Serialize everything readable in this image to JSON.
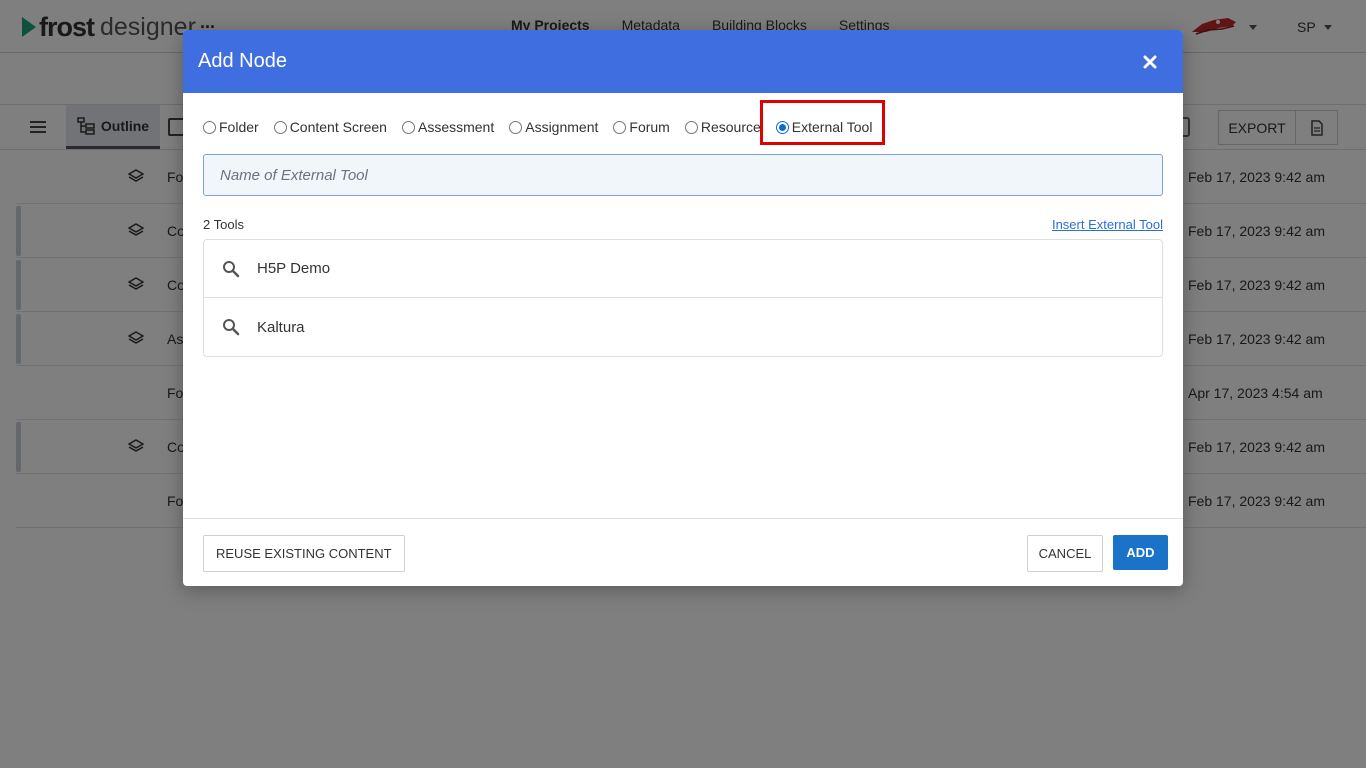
{
  "app": {
    "logo_primary": "frost",
    "logo_secondary": "designer",
    "more_label": "...",
    "nav": [
      "My Projects",
      "Metadata",
      "Building Blocks",
      "Settings"
    ],
    "user_initials": "SP"
  },
  "toolbar": {
    "outline_label": "Outline",
    "export_label": "EXPORT"
  },
  "background_rows": [
    {
      "name": "Fo",
      "date": "Feb 17, 2023 9:42 am"
    },
    {
      "name": "Co",
      "date": "Feb 17, 2023 9:42 am"
    },
    {
      "name": "Co",
      "date": "Feb 17, 2023 9:42 am"
    },
    {
      "name": "As",
      "date": "Feb 17, 2023 9:42 am"
    },
    {
      "name": "Fo",
      "date": "Apr 17, 2023 4:54 am"
    },
    {
      "name": "Co",
      "date": "Feb 17, 2023 9:42 am"
    },
    {
      "name": "Fo",
      "date": "Feb 17, 2023 9:42 am"
    }
  ],
  "modal": {
    "title": "Add Node",
    "node_types": [
      "Folder",
      "Content Screen",
      "Assessment",
      "Assignment",
      "Forum",
      "Resource",
      "External Tool"
    ],
    "selected_type": "External Tool",
    "name_placeholder": "Name of External Tool",
    "tools_count": "2 Tools",
    "insert_link": "Insert External Tool",
    "tools": [
      "H5P Demo",
      "Kaltura"
    ],
    "reuse_label": "REUSE EXISTING CONTENT",
    "cancel_label": "CANCEL",
    "add_label": "ADD"
  },
  "colors": {
    "header_blue": "#3f6ee0",
    "add_button": "#1a73c9",
    "highlight": "#e00000",
    "logo_green": "#1aa37a"
  }
}
